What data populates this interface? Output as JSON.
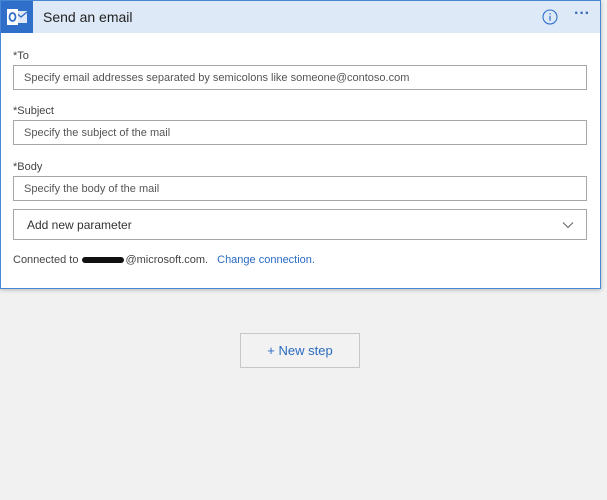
{
  "action_card": {
    "title": "Send an email",
    "app_icon": "outlook-icon",
    "info_icon": "info-icon",
    "more_icon": "more-options-icon",
    "more_glyph": "···",
    "accent_color": "#2f6fc9",
    "header_bg": "#dde9f7",
    "fields": [
      {
        "required_mark": "*",
        "label": "To",
        "value": "",
        "placeholder": "Specify email addresses separated by semicolons like someone@contoso.com"
      },
      {
        "required_mark": "*",
        "label": "Subject",
        "value": "",
        "placeholder": "Specify the subject of the mail"
      },
      {
        "required_mark": "*",
        "label": "Body",
        "value": "",
        "placeholder": "Specify the body of the mail"
      }
    ],
    "add_parameter": {
      "label": "Add new parameter",
      "icon": "chevron-down-icon"
    },
    "connection": {
      "prefix": "Connected to",
      "account_suffix": "@microsoft.com.",
      "change_link": "Change connection."
    }
  },
  "new_step": {
    "label": "+ New step",
    "link_color": "#2a6bc2"
  }
}
